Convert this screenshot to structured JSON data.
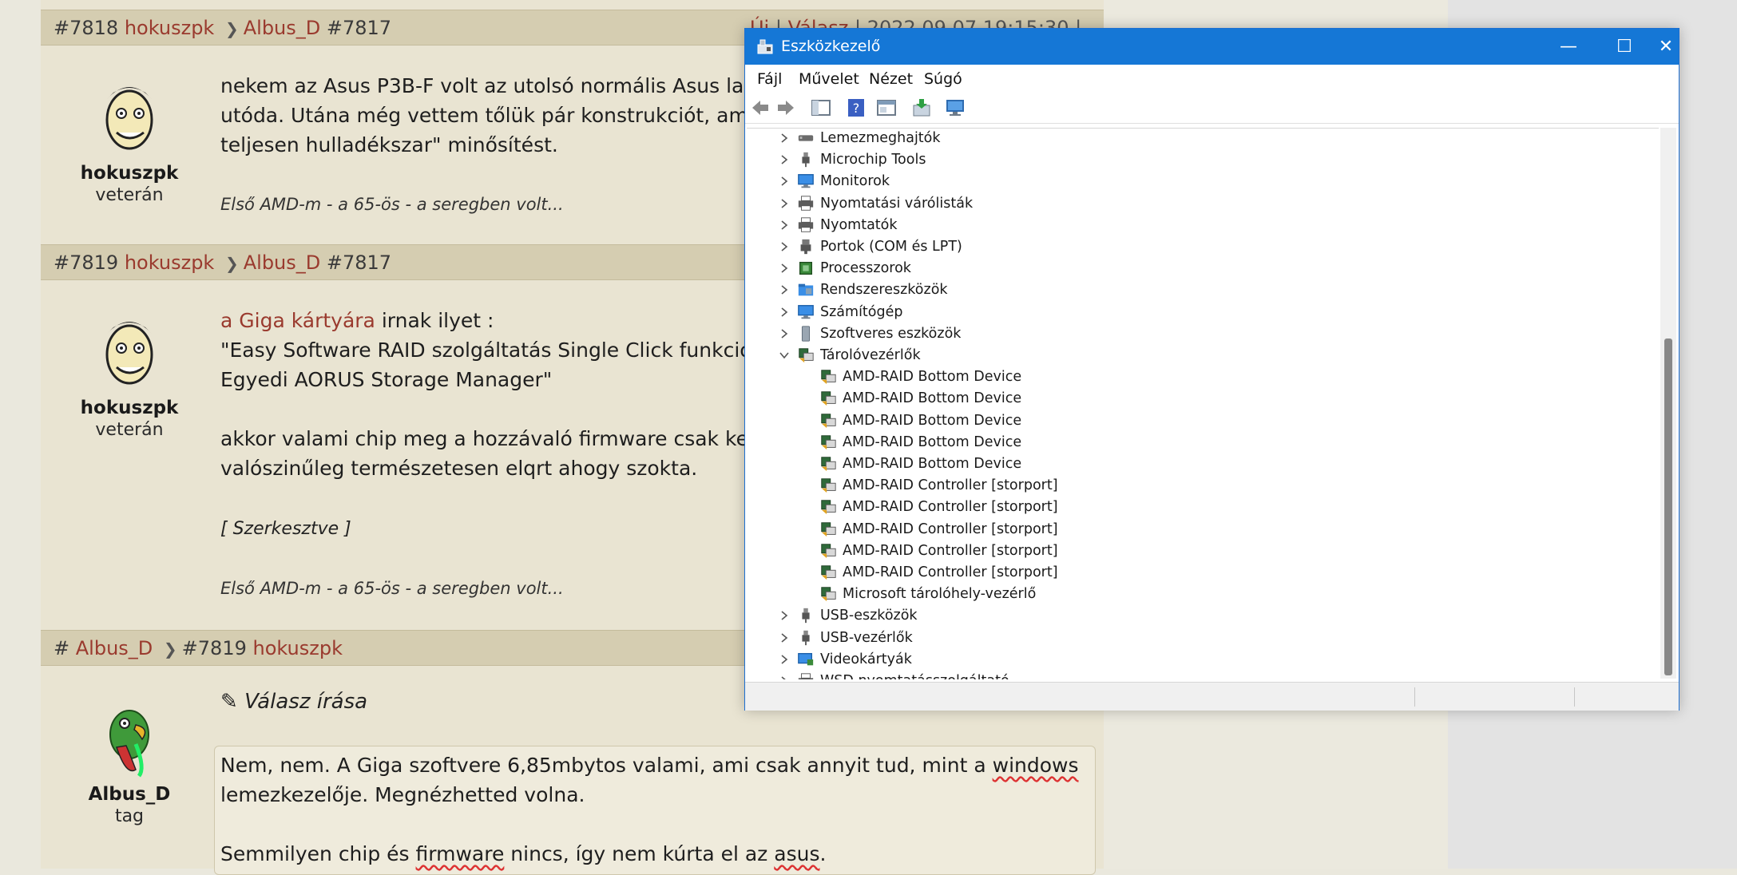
{
  "posts": [
    {
      "num": "#7818",
      "author": "hokuszpk",
      "reply_to": "Albus_D",
      "reply_num": "#7817",
      "actions": {
        "new": "Új",
        "reply": "Válasz",
        "timestamp": "2022.09.07 19:15:30"
      },
      "user_name": "hokuszpk",
      "user_rank": "veterán",
      "text": "nekem az Asus P3B-F volt az utolsó normális Asus lapom\nutóda. Utána még vettem tőlük pár konstrukciót, amig el\nteljesen hulladékszar\" minősítést.",
      "signature": "Első AMD-m - a 65-ös - a seregben volt..."
    },
    {
      "num": "#7819",
      "author": "hokuszpk",
      "reply_to": "Albus_D",
      "reply_num": "#7817",
      "user_name": "hokuszpk",
      "user_rank": "veterán",
      "link_text": "a Giga kártyára",
      "text_after_link": " irnak ilyet :",
      "text": "\"Easy Software RAID szolgáltatás Single Click funkcióval\nEgyedi AORUS Storage Manager\"\n\nakkor valami chip meg a hozzávaló firmware csak kell leg\nvalószinűleg természetesen elqrt ahogy szokta.",
      "edited": "[ Szerkesztve ]",
      "signature": "Első AMD-m - a 65-ös - a seregben volt..."
    },
    {
      "num": "#",
      "author": "Albus_D",
      "reply_num": "#7819",
      "reply_to": "hokuszpk",
      "user_name": "Albus_D",
      "user_rank": "tag"
    }
  ],
  "reply_form": {
    "title": "Válasz írása",
    "line1_a": "Nem, nem. A Giga szoftvere 6,85mbytos valami, ami csak annyit tud, mint a ",
    "line1_b": "windows",
    "line2": "lemezkezelője. Megnézhetted volna.",
    "line3_a": "Semmilyen chip és ",
    "line3_b": "firmware",
    "line3_c": " nincs, így nem kúrta el az ",
    "line3_d": "asus",
    "line3_e": "."
  },
  "device_manager": {
    "title": "Eszközkezelő",
    "menu": [
      "Fájl",
      "Művelet",
      "Nézet",
      "Súgó"
    ],
    "tree": [
      {
        "label": "Lemezmeghajtók",
        "level": 0,
        "expanded": false,
        "icon": "disk-icon"
      },
      {
        "label": "Microchip Tools",
        "level": 0,
        "expanded": false,
        "icon": "usb-plug-icon"
      },
      {
        "label": "Monitorok",
        "level": 0,
        "expanded": false,
        "icon": "monitor-icon"
      },
      {
        "label": "Nyomtatási várólisták",
        "level": 0,
        "expanded": false,
        "icon": "printer-icon"
      },
      {
        "label": "Nyomtatók",
        "level": 0,
        "expanded": false,
        "icon": "printer-icon"
      },
      {
        "label": "Portok (COM és LPT)",
        "level": 0,
        "expanded": false,
        "icon": "port-icon"
      },
      {
        "label": "Processzorok",
        "level": 0,
        "expanded": false,
        "icon": "cpu-icon"
      },
      {
        "label": "Rendszereszközök",
        "level": 0,
        "expanded": false,
        "icon": "folder-icon"
      },
      {
        "label": "Számítógép",
        "level": 0,
        "expanded": false,
        "icon": "monitor-icon"
      },
      {
        "label": "Szoftveres eszközök",
        "level": 0,
        "expanded": false,
        "icon": "software-device-icon"
      },
      {
        "label": "Tárolóvezérlők",
        "level": 0,
        "expanded": true,
        "icon": "storage-controller-icon"
      },
      {
        "label": "AMD-RAID Bottom Device",
        "level": 1,
        "icon": "storage-controller-icon"
      },
      {
        "label": "AMD-RAID Bottom Device",
        "level": 1,
        "icon": "storage-controller-icon"
      },
      {
        "label": "AMD-RAID Bottom Device",
        "level": 1,
        "icon": "storage-controller-icon"
      },
      {
        "label": "AMD-RAID Bottom Device",
        "level": 1,
        "icon": "storage-controller-icon"
      },
      {
        "label": "AMD-RAID Bottom Device",
        "level": 1,
        "icon": "storage-controller-icon"
      },
      {
        "label": "AMD-RAID Controller [storport]",
        "level": 1,
        "icon": "storage-controller-icon"
      },
      {
        "label": "AMD-RAID Controller [storport]",
        "level": 1,
        "icon": "storage-controller-icon"
      },
      {
        "label": "AMD-RAID Controller [storport]",
        "level": 1,
        "icon": "storage-controller-icon"
      },
      {
        "label": "AMD-RAID Controller [storport]",
        "level": 1,
        "icon": "storage-controller-icon"
      },
      {
        "label": "AMD-RAID Controller [storport]",
        "level": 1,
        "icon": "storage-controller-icon"
      },
      {
        "label": "Microsoft tárolóhely-vezérlő",
        "level": 1,
        "icon": "storage-controller-icon"
      },
      {
        "label": "USB-eszközök",
        "level": 0,
        "expanded": false,
        "icon": "usb-plug-icon"
      },
      {
        "label": "USB-vezérlők",
        "level": 0,
        "expanded": false,
        "icon": "usb-plug-icon"
      },
      {
        "label": "Videokártyák",
        "level": 0,
        "expanded": false,
        "icon": "display-adapter-icon"
      },
      {
        "label": "WSD nyomtatásszolgáltató",
        "level": 0,
        "expanded": false,
        "icon": "printer-icon"
      }
    ]
  },
  "colors": {
    "accent_link": "#9a3a2e",
    "titlebar": "#1577d6",
    "forum_bg": "#e9e4d2",
    "post_header": "#d5cdb1"
  }
}
